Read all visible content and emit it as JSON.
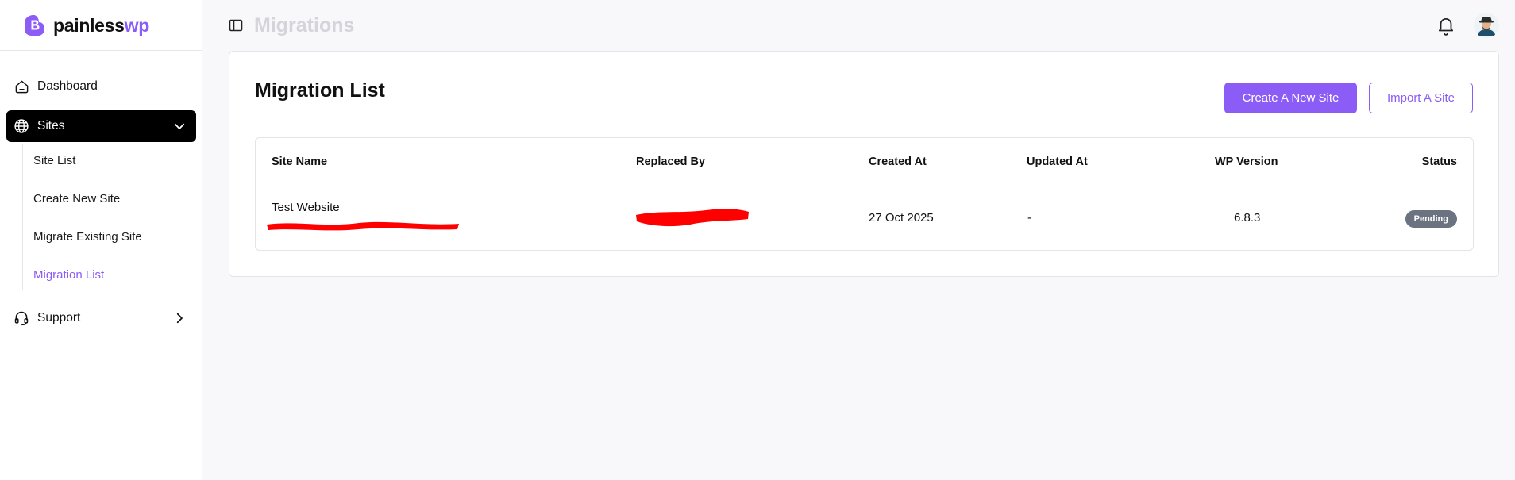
{
  "brand": {
    "name_main": "painless",
    "name_accent": "wp"
  },
  "sidebar": {
    "items": [
      {
        "label": "Dashboard",
        "icon": "home-icon"
      },
      {
        "label": "Sites",
        "icon": "globe-icon",
        "expanded": true
      },
      {
        "label": "Support",
        "icon": "headset-icon"
      }
    ],
    "sub_items": [
      {
        "label": "Site List"
      },
      {
        "label": "Create New Site"
      },
      {
        "label": "Migrate Existing Site"
      },
      {
        "label": "Migration List",
        "active": true
      }
    ]
  },
  "header": {
    "title": "Migrations"
  },
  "main": {
    "title": "Migration List",
    "create_button": "Create A New Site",
    "import_button": "Import A Site",
    "table": {
      "columns": [
        "Site Name",
        "Replaced By",
        "Created At",
        "Updated At",
        "WP Version",
        "Status"
      ],
      "rows": [
        {
          "site_name": "Test Website",
          "replaced_by": "",
          "created_at": "27 Oct 2025",
          "updated_at": "-",
          "wp_version": "6.8.3",
          "status": "Pending"
        }
      ]
    }
  },
  "colors": {
    "accent": "#8b5cf6",
    "active_nav_bg": "#000000",
    "badge_bg": "#6b7280",
    "redaction": "#ff0000"
  }
}
